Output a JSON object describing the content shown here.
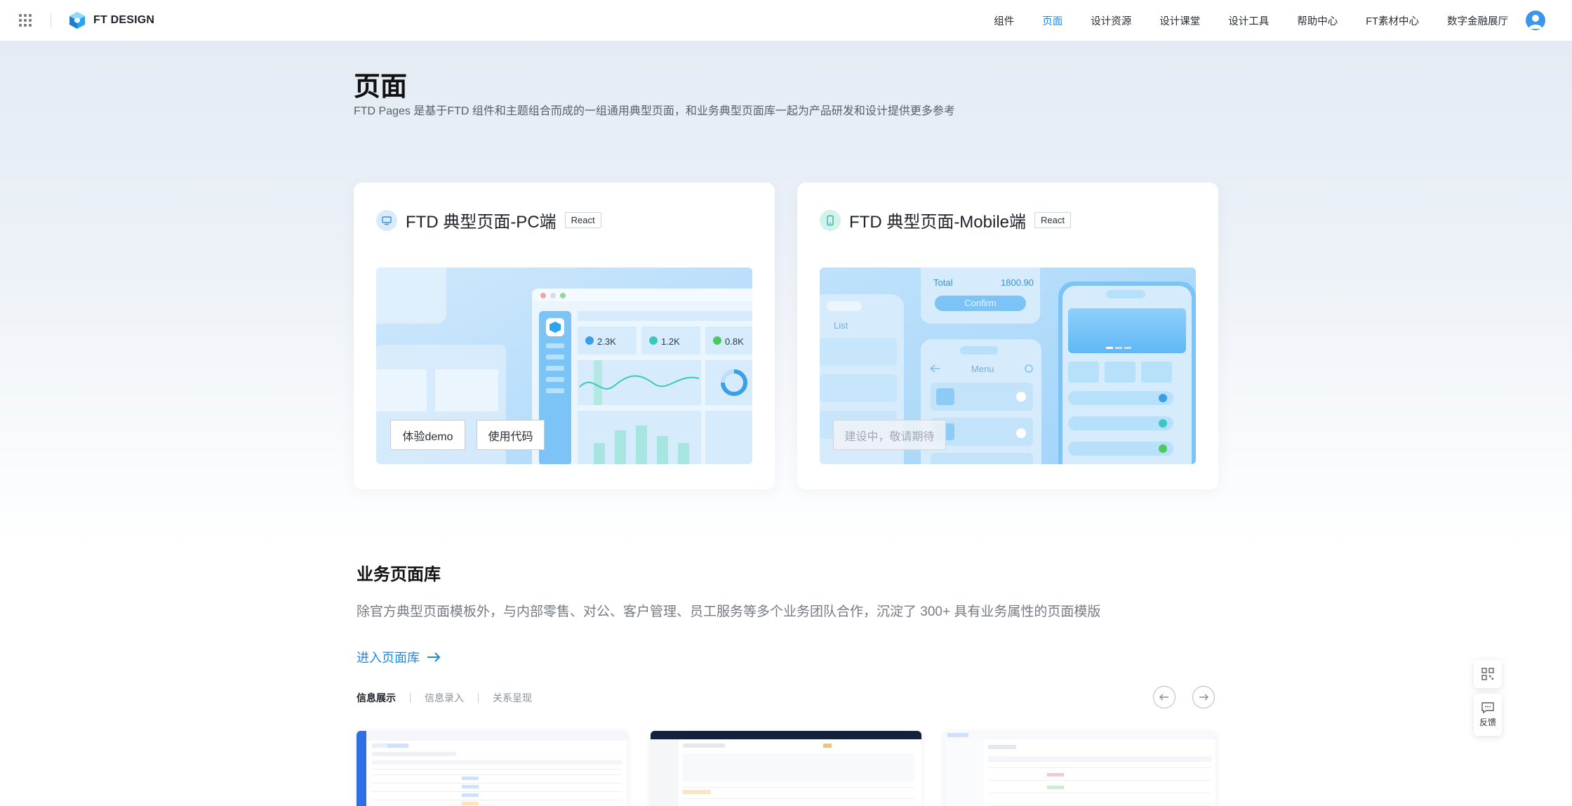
{
  "header": {
    "logo_text": "FT DESIGN",
    "nav": [
      {
        "label": "组件"
      },
      {
        "label": "页面",
        "active": true
      },
      {
        "label": "设计资源"
      },
      {
        "label": "设计课堂"
      },
      {
        "label": "设计工具"
      },
      {
        "label": "帮助中心"
      },
      {
        "label": "FT素材中心"
      },
      {
        "label": "数字金融展厅"
      }
    ]
  },
  "hero": {
    "title": "页面",
    "subtitle": "FTD Pages 是基于FTD 组件和主题组合而成的一组通用典型页面，和业务典型页面库一起为产品研发和设计提供更多参考"
  },
  "cards": [
    {
      "title": "FTD 典型页面-PC端",
      "tag": "React",
      "stats": [
        "2.3K",
        "1.2K",
        "0.8K"
      ],
      "buttons": [
        "体验demo",
        "使用代码"
      ]
    },
    {
      "title": "FTD 典型页面-Mobile端",
      "tag": "React",
      "mock": {
        "total_label": "Total",
        "total_value": "1800.90",
        "confirm": "Confirm",
        "list": "List",
        "menu": "Menu"
      },
      "status": "建设中，敬请期待"
    }
  ],
  "library": {
    "title": "业务页面库",
    "subtitle": "除官方典型页面模板外，与内部零售、对公、客户管理、员工服务等多个业务团队合作，沉淀了 300+ 具有业务属性的页面模版",
    "link": "进入页面库",
    "tabs": [
      {
        "label": "信息展示",
        "active": true
      },
      {
        "label": "信息录入"
      },
      {
        "label": "关系呈现"
      }
    ]
  },
  "float_tools": {
    "feedback_label": "反馈"
  },
  "colors": {
    "accent": "#1e88e5",
    "text": "#1d2129",
    "muted": "#767b84"
  }
}
